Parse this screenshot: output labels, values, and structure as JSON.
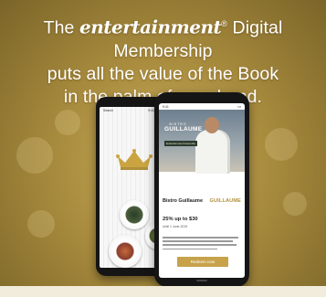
{
  "headline": {
    "brand": "entertainment",
    "brand_mark": "®",
    "line1_rest": " Digital Membership",
    "line2": "puts all the value of the Book",
    "line3": "in the palm of your hand."
  },
  "left_phone": {
    "status_left": "Search",
    "status_right": "9:41 AM",
    "crown_icon": "crown-icon",
    "colors": {
      "crown": "#c9a440"
    }
  },
  "right_phone": {
    "status_time": "9:41",
    "hero_logo_small": "BISTRO",
    "hero_logo_large": "GUILLAUME",
    "hero_badge": "Entertainment Favourite",
    "restaurant_name": "Bistro Guillaume",
    "restaurant_logo": "GUILLAUME",
    "offer": "25% up to $30",
    "valid_until": "Until 1 June 2019",
    "redeem_label": "Redeem now",
    "colors": {
      "accent": "#c7a24b"
    }
  }
}
